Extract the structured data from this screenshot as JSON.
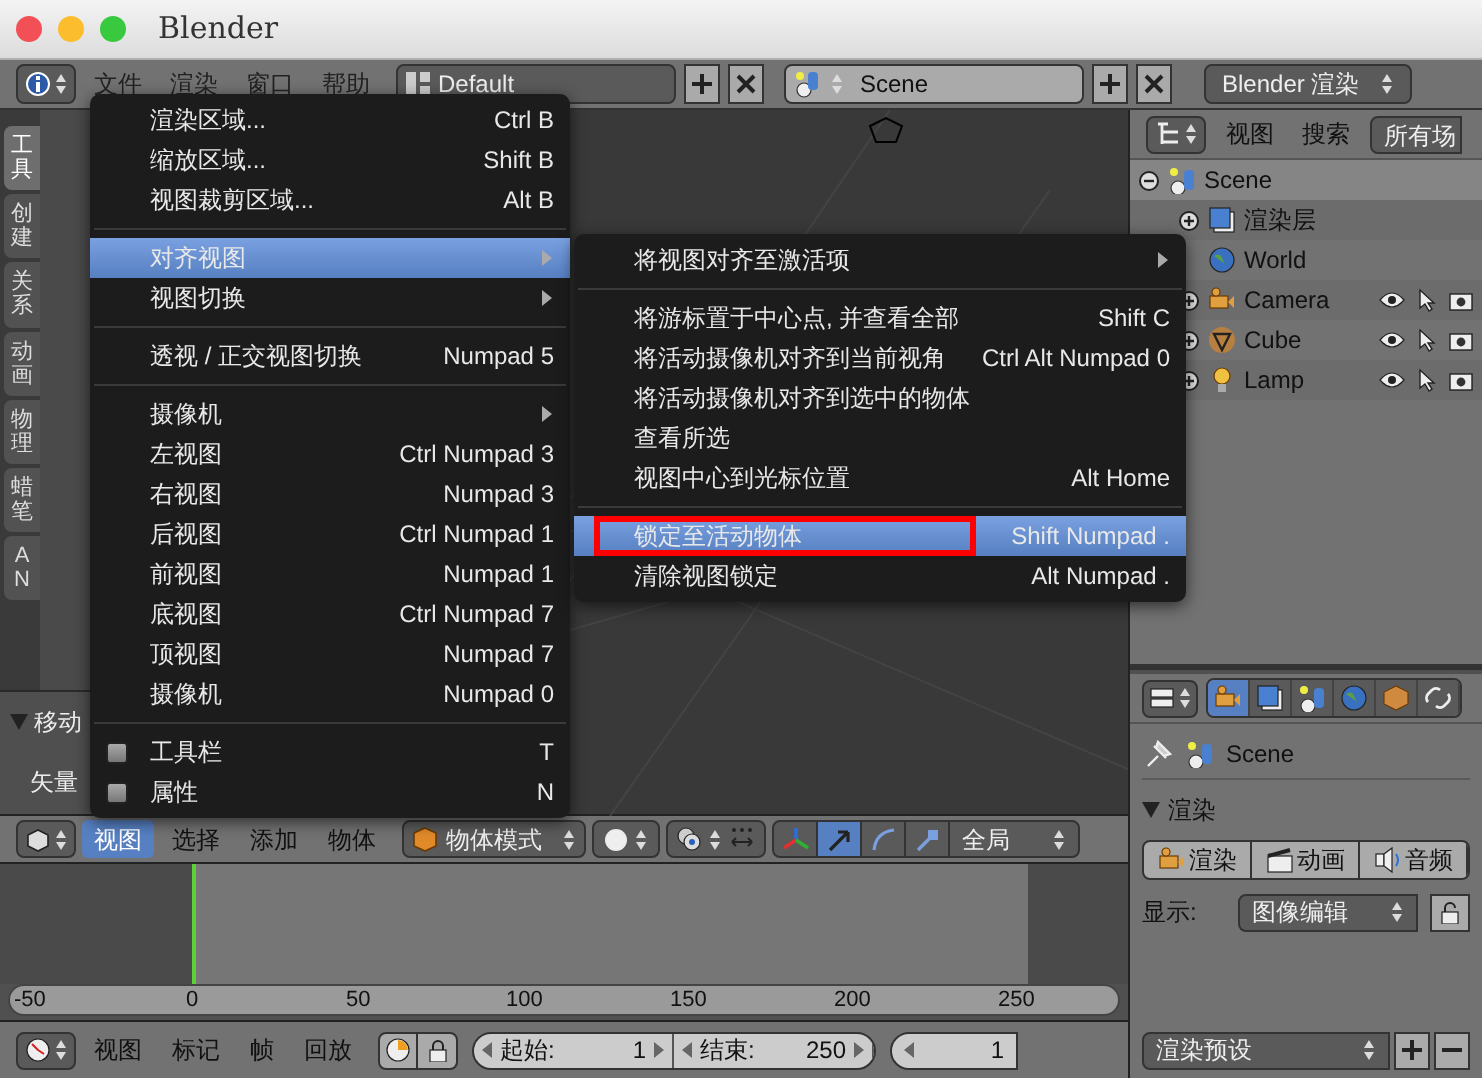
{
  "window": {
    "title": "Blender"
  },
  "top_header": {
    "menus": [
      "文件",
      "渲染",
      "窗口",
      "帮助"
    ],
    "layout": "Default",
    "scene": "Scene",
    "engine": "Blender 渲染"
  },
  "tool_tabs": [
    {
      "label": "工具",
      "selected": true
    },
    {
      "label": "创建",
      "selected": false
    },
    {
      "label": "关系",
      "selected": false
    },
    {
      "label": "动画",
      "selected": false
    },
    {
      "label": "物理",
      "selected": false
    },
    {
      "label": "蜡笔",
      "selected": false
    },
    {
      "label": "AN",
      "selected": false
    }
  ],
  "operator_panel": {
    "title": "移动",
    "field_label": "矢量"
  },
  "view_menu": {
    "items": [
      {
        "kind": "item",
        "label": "渲染区域...",
        "shortcut": "Ctrl B",
        "submenu": false,
        "highlighted": false
      },
      {
        "kind": "item",
        "label": "缩放区域...",
        "shortcut": "Shift B",
        "submenu": false,
        "highlighted": false
      },
      {
        "kind": "item",
        "label": "视图裁剪区域...",
        "shortcut": "Alt B",
        "submenu": false,
        "highlighted": false
      },
      {
        "kind": "separator"
      },
      {
        "kind": "item",
        "label": "对齐视图",
        "submenu": true,
        "highlighted": true
      },
      {
        "kind": "item",
        "label": "视图切换",
        "submenu": true,
        "highlighted": false
      },
      {
        "kind": "separator"
      },
      {
        "kind": "item",
        "label": "透视 / 正交视图切换",
        "shortcut": "Numpad 5",
        "submenu": false,
        "highlighted": false
      },
      {
        "kind": "separator"
      },
      {
        "kind": "item",
        "label": "摄像机",
        "submenu": true,
        "highlighted": false
      },
      {
        "kind": "item",
        "label": "左视图",
        "shortcut": "Ctrl Numpad 3",
        "submenu": false,
        "highlighted": false
      },
      {
        "kind": "item",
        "label": "右视图",
        "shortcut": "Numpad 3",
        "submenu": false,
        "highlighted": false
      },
      {
        "kind": "item",
        "label": "后视图",
        "shortcut": "Ctrl Numpad 1",
        "submenu": false,
        "highlighted": false
      },
      {
        "kind": "item",
        "label": "前视图",
        "shortcut": "Numpad 1",
        "submenu": false,
        "highlighted": false
      },
      {
        "kind": "item",
        "label": "底视图",
        "shortcut": "Ctrl Numpad 7",
        "submenu": false,
        "highlighted": false
      },
      {
        "kind": "item",
        "label": "顶视图",
        "shortcut": "Numpad 7",
        "submenu": false,
        "highlighted": false
      },
      {
        "kind": "item",
        "label": "摄像机",
        "shortcut": "Numpad 0",
        "submenu": false,
        "highlighted": false
      },
      {
        "kind": "separator"
      },
      {
        "kind": "checkbox",
        "label": "工具栏",
        "shortcut": "T",
        "checked": false
      },
      {
        "kind": "checkbox",
        "label": "属性",
        "shortcut": "N",
        "checked": false
      }
    ]
  },
  "align_submenu": {
    "items": [
      {
        "kind": "item",
        "label": "将视图对齐至激活项",
        "submenu": true,
        "highlighted": false,
        "boxed": false
      },
      {
        "kind": "separator"
      },
      {
        "kind": "item",
        "label": "将游标置于中心点, 并查看全部",
        "shortcut": "Shift C",
        "submenu": false,
        "highlighted": false,
        "boxed": false
      },
      {
        "kind": "item",
        "label": "将活动摄像机对齐到当前视角",
        "shortcut": "Ctrl Alt Numpad 0",
        "submenu": false,
        "highlighted": false,
        "boxed": false
      },
      {
        "kind": "item",
        "label": "将活动摄像机对齐到选中的物体",
        "submenu": false,
        "highlighted": false,
        "boxed": false
      },
      {
        "kind": "item",
        "label": "查看所选",
        "submenu": false,
        "highlighted": false,
        "boxed": false
      },
      {
        "kind": "item",
        "label": "视图中心到光标位置",
        "shortcut": "Alt Home",
        "submenu": false,
        "highlighted": false,
        "boxed": false
      },
      {
        "kind": "separator"
      },
      {
        "kind": "item",
        "label": "锁定至活动物体",
        "shortcut": "Shift Numpad .",
        "submenu": false,
        "highlighted": true,
        "boxed": true
      },
      {
        "kind": "item",
        "label": "清除视图锁定",
        "shortcut": "Alt Numpad .",
        "submenu": false,
        "highlighted": false,
        "boxed": false
      }
    ]
  },
  "viewport_header": {
    "menus": [
      {
        "label": "视图",
        "selected": true
      },
      {
        "label": "选择",
        "selected": false
      },
      {
        "label": "添加",
        "selected": false
      },
      {
        "label": "物体",
        "selected": false
      }
    ],
    "mode": "物体模式",
    "orientation": "全局"
  },
  "timeline": {
    "ruler": [
      "-50",
      "0",
      "50",
      "100",
      "150",
      "200",
      "250"
    ]
  },
  "timeline_header": {
    "menus": [
      "视图",
      "标记",
      "帧",
      "回放"
    ],
    "start_label": "起始:",
    "start": "1",
    "end_label": "结束:",
    "end": "250",
    "current": "1"
  },
  "outliner": {
    "menus": [
      "视图",
      "搜索"
    ],
    "filter": "所有场",
    "tree": [
      {
        "label": "Scene",
        "kind": "scene",
        "expanded": true,
        "children": [
          {
            "label": "渲染层",
            "kind": "renderlayer",
            "expanded": false
          },
          {
            "label": "World",
            "kind": "world"
          },
          {
            "label": "Camera",
            "kind": "camera",
            "expanded": false
          },
          {
            "label": "Cube",
            "kind": "mesh",
            "expanded": false
          },
          {
            "label": "Lamp",
            "kind": "lamp",
            "expanded": false
          }
        ]
      }
    ]
  },
  "properties": {
    "tabs": [
      {
        "kind": "render",
        "selected": true
      },
      {
        "kind": "renderlayer",
        "selected": false
      },
      {
        "kind": "scene",
        "selected": false
      },
      {
        "kind": "world",
        "selected": false
      },
      {
        "kind": "object",
        "selected": false
      },
      {
        "kind": "constraint",
        "selected": false
      }
    ],
    "context": "Scene",
    "panel": "渲染",
    "buttons": [
      "渲染",
      "动画",
      "音频"
    ],
    "display_label": "显示:",
    "display": "图像编辑",
    "preset": "渲染预设"
  }
}
